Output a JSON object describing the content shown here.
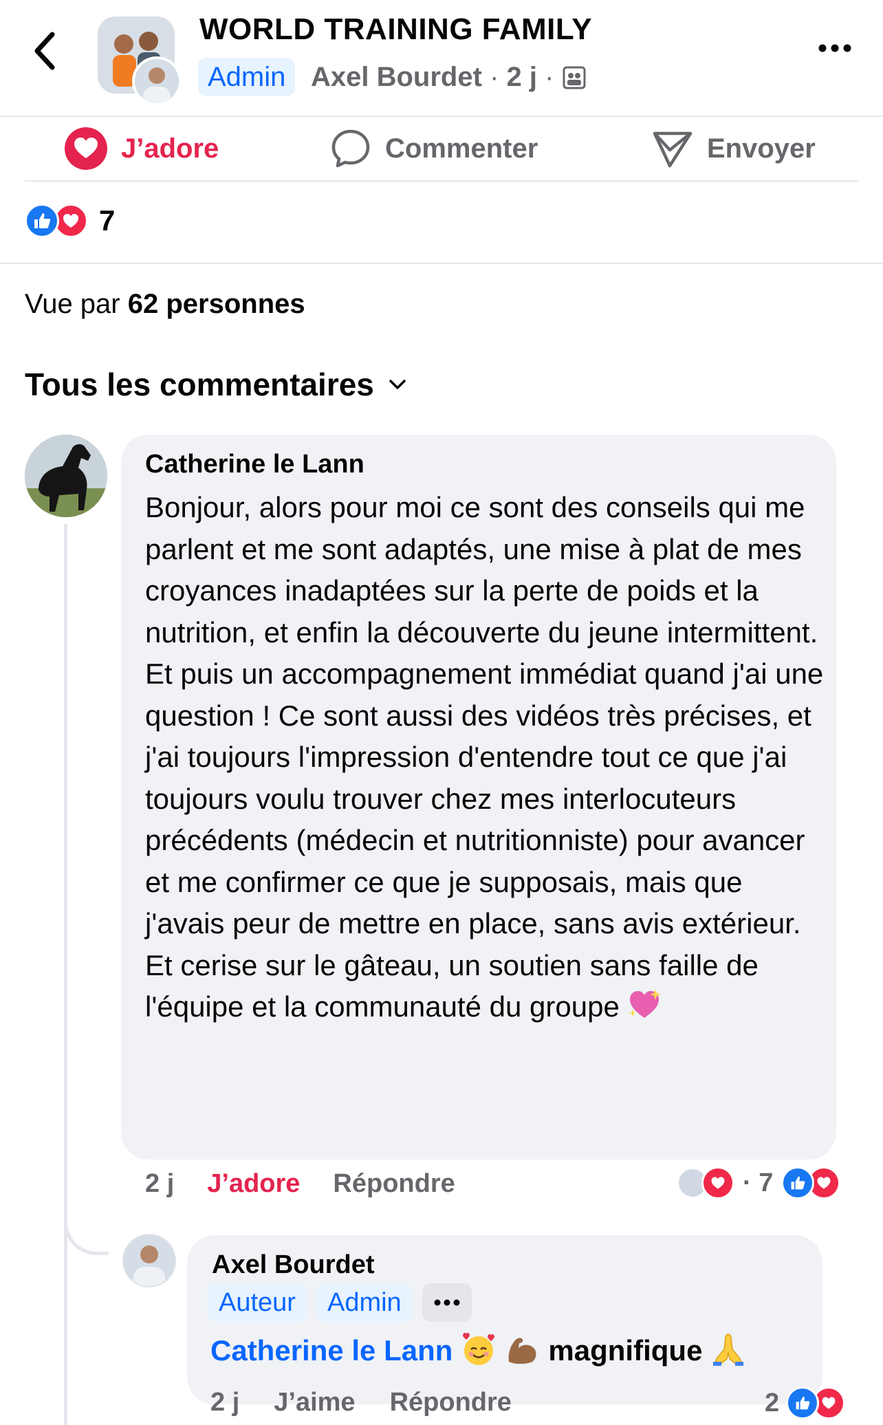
{
  "header": {
    "group_name": "WORLD TRAINING FAMILY",
    "admin_badge": "Admin",
    "author": "Axel Bourdet",
    "time": "2 j",
    "sep": "·"
  },
  "actions": {
    "love": "J’adore",
    "comment": "Commenter",
    "send": "Envoyer"
  },
  "reactions": {
    "count": "7"
  },
  "seen": {
    "prefix": "Vue par",
    "count_text": "62 personnes"
  },
  "comments_filter": "Tous les commentaires",
  "comment": {
    "author": "Catherine le Lann",
    "text": "Bonjour, alors pour moi ce sont des conseils qui me parlent et me sont adaptés, une mise à plat de mes croyances inadaptées sur la perte de poids et la nutrition, et enfin la découverte du jeune intermittent. Et puis un accompagnement immédiat quand j'ai une question ! Ce sont aussi des vidéos très précises, et j'ai toujours l'impression d'entendre tout ce que j'ai toujours voulu trouver chez mes interlocuteurs précédents (médecin et nutritionniste) pour avancer et me confirmer ce que je supposais, mais que j'avais peur de mettre en place, sans avis extérieur. Et cerise sur le gâteau, un soutien sans faille de l'équipe et la communauté du groupe",
    "time": "2 j",
    "love": "J’adore",
    "reply": "Répondre",
    "reaction_count": "· 7"
  },
  "reply": {
    "author": "Axel Bourdet",
    "badge_author": "Auteur",
    "badge_admin": "Admin",
    "mention": "Catherine le Lann",
    "text": "magnifique",
    "time": "2 j",
    "like": "J’aime",
    "reply": "Répondre",
    "reaction_count": "2"
  },
  "colors": {
    "accent_blue": "#0866ff",
    "love_red": "#e4234e",
    "bubble_bg": "#f0f2f5",
    "muted": "#65676b"
  }
}
